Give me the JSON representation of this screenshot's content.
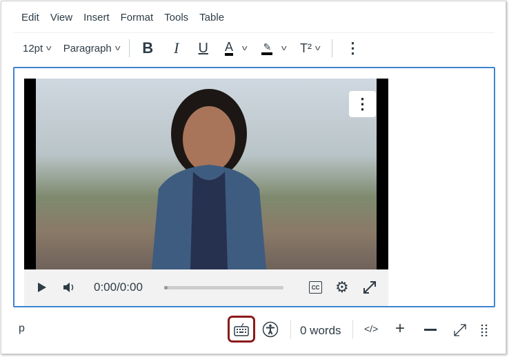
{
  "menubar": {
    "items": [
      "Edit",
      "View",
      "Insert",
      "Format",
      "Tools",
      "Table"
    ]
  },
  "toolbar": {
    "font_size": "12pt",
    "block_format": "Paragraph",
    "bold": "B",
    "italic": "I",
    "underline": "U",
    "text_color": "A",
    "superscript": "T²"
  },
  "video": {
    "time": "0:00/0:00",
    "progress": 0.02,
    "cc": "CC"
  },
  "statusbar": {
    "path": "p",
    "word_count": "0 words",
    "html_toggle": "</>"
  },
  "colors": {
    "accent": "#3d83cf",
    "highlight_border": "#8b1a1a"
  }
}
